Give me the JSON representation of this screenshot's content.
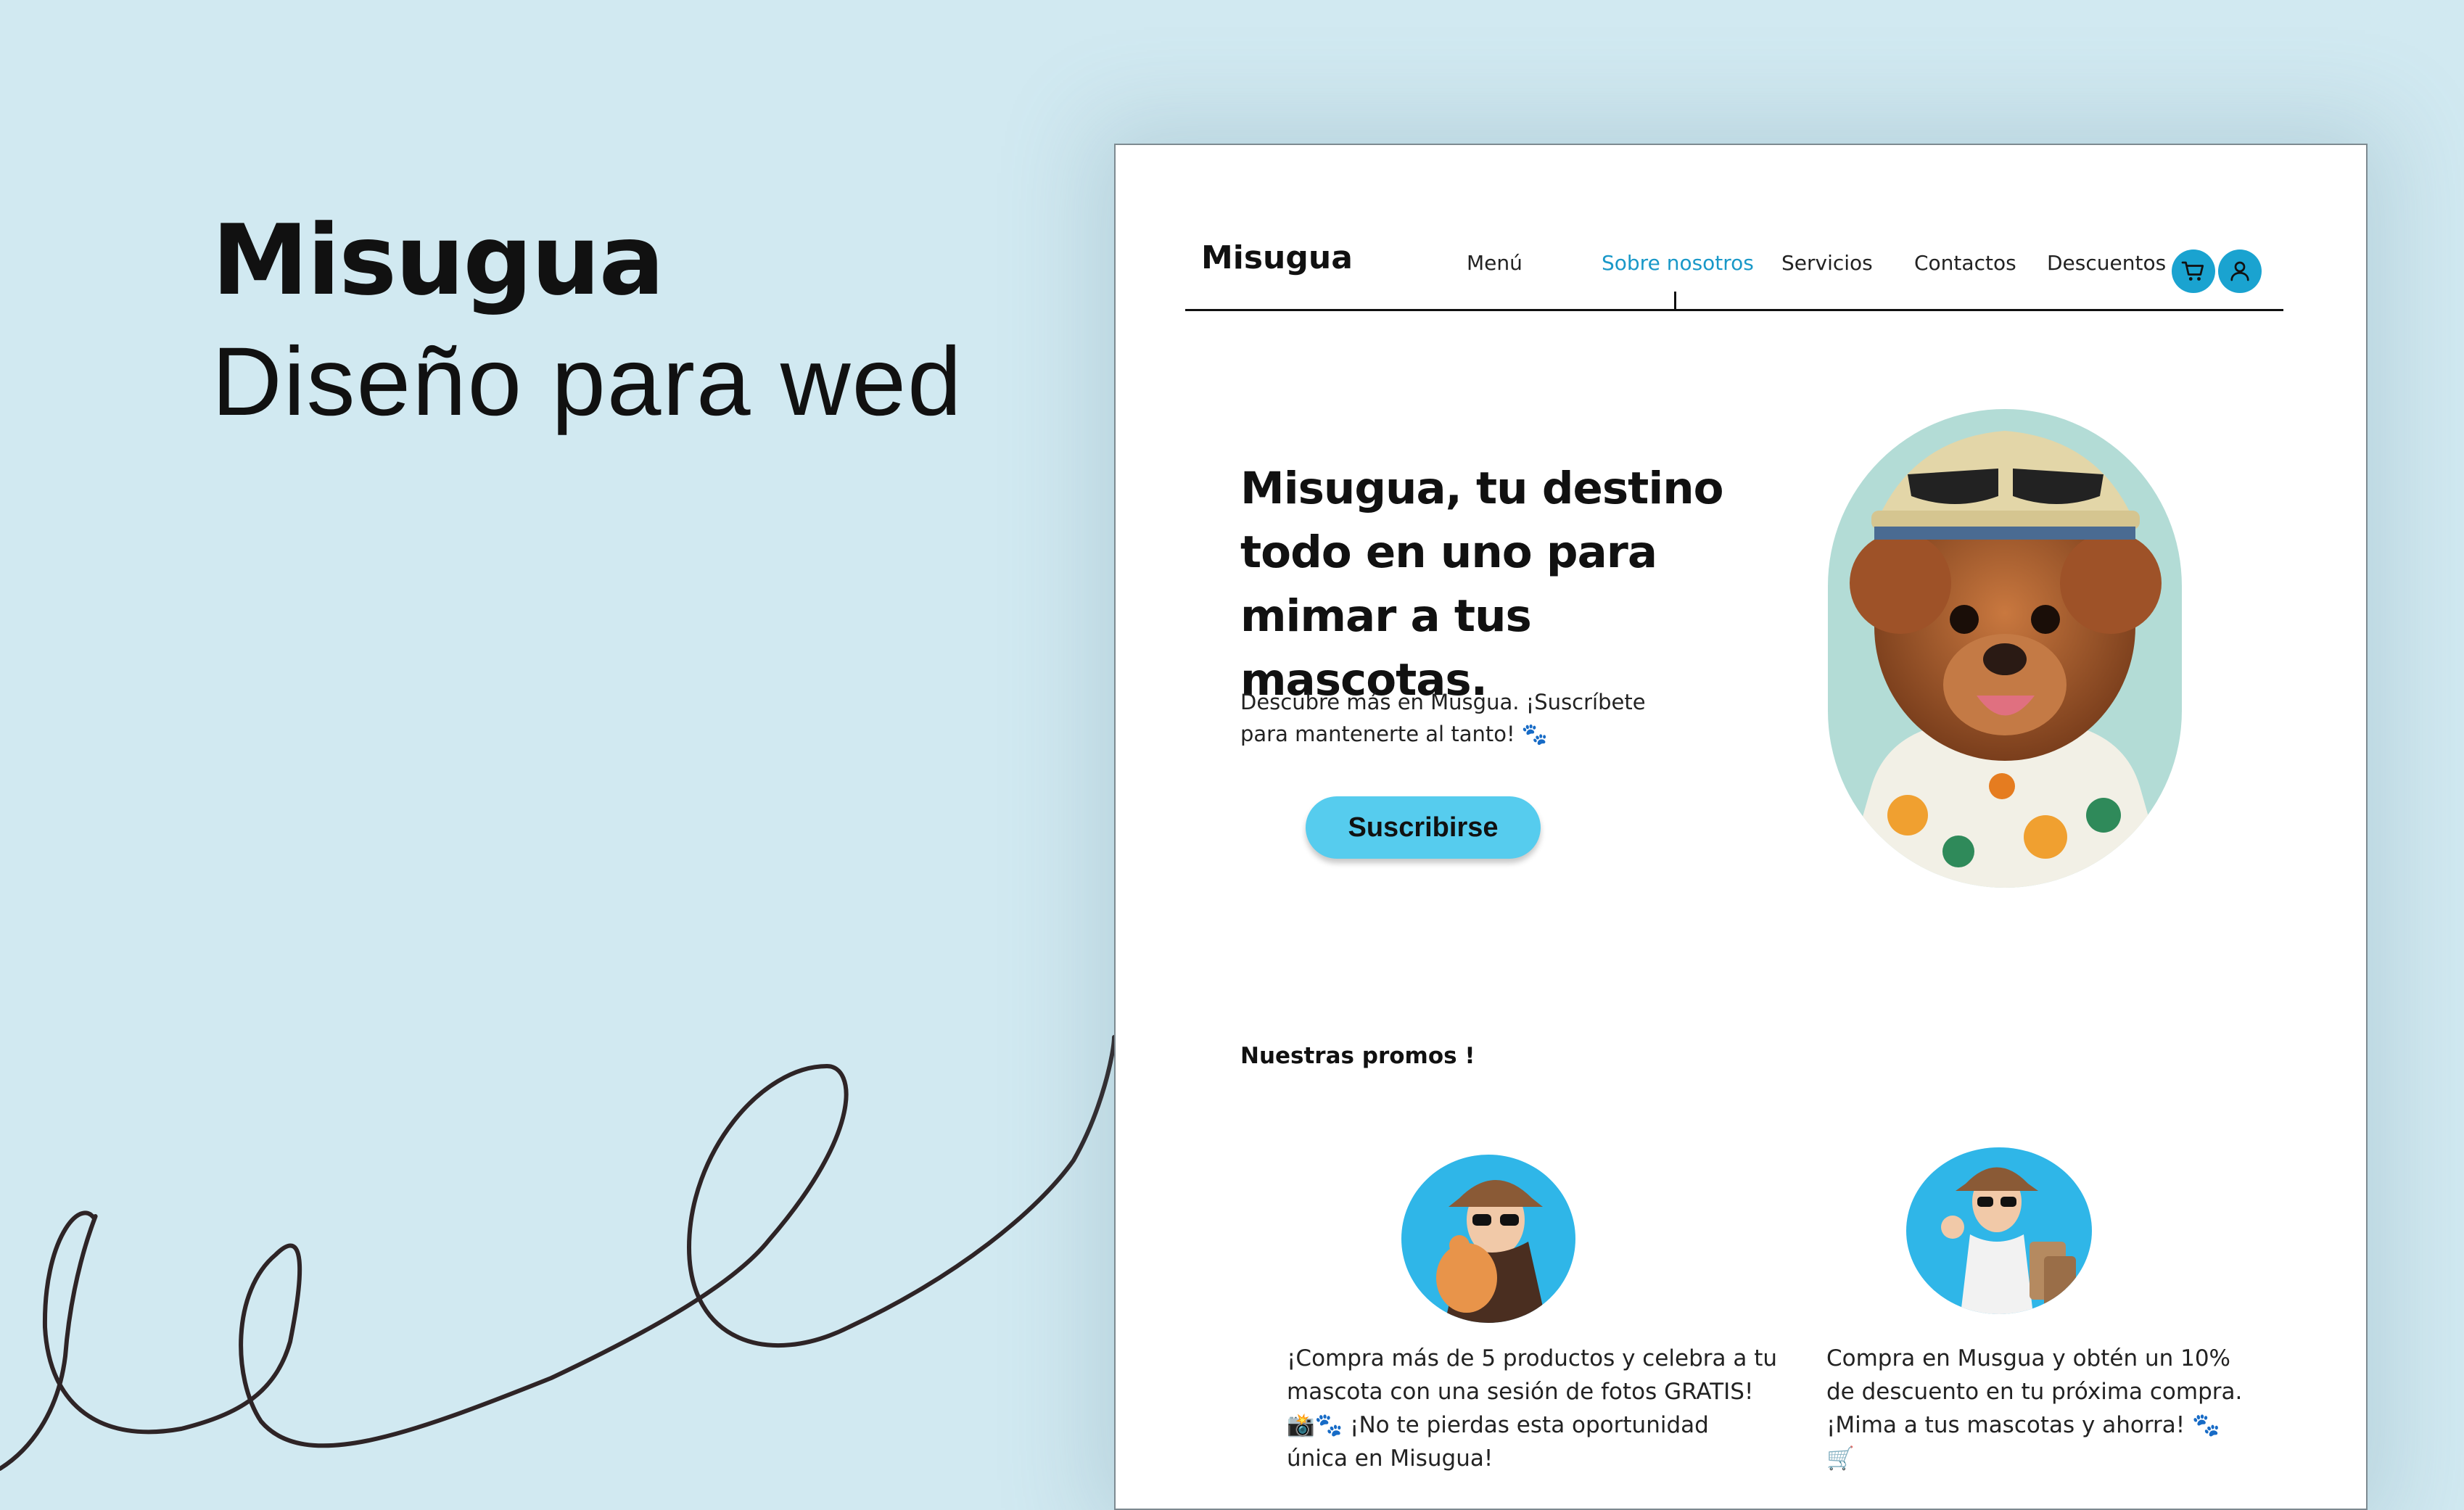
{
  "showcase": {
    "title": "Misugua",
    "subtitle": "Diseño para wed"
  },
  "navbar": {
    "logo": "Misugua",
    "links": [
      {
        "label": "Menú",
        "active": false
      },
      {
        "label": "Sobre nosotros",
        "active": true
      },
      {
        "label": "Servicios",
        "active": false
      },
      {
        "label": "Contactos",
        "active": false
      },
      {
        "label": "Descuentos",
        "active": false
      }
    ],
    "icons": [
      "cart-icon",
      "user-icon"
    ]
  },
  "hero": {
    "title": "Misugua, tu destino todo en uno para mimar a tus mascotas.",
    "description_line1": "Descubre más en Musgua. ¡Suscríbete",
    "description_line2": "para mantenerte al tanto! 🐾",
    "button_label": "Suscribirse",
    "image": "dog-with-hat-and-sunglasses"
  },
  "promos": {
    "heading": "Nuestras promos !",
    "items": [
      {
        "image": "woman-holding-cat",
        "lines": [
          "¡Compra más de 5 productos y celebra a tu",
          "mascota con una sesión de fotos GRATIS!",
          "📸🐾 ¡No te pierdas esta oportunidad",
          "única en Misugua!"
        ]
      },
      {
        "image": "woman-with-shopping-bags",
        "lines": [
          "Compra en Musgua y obtén un 10%",
          "de descuento en tu próxima compra.",
          "¡Mima a tus mascotas y ahorra! 🐾",
          "🛒"
        ]
      }
    ]
  },
  "colors": {
    "background": "#d1e9f1",
    "accent": "#1aa3d0",
    "active_link": "#1998c8",
    "button": "#56ccee"
  }
}
